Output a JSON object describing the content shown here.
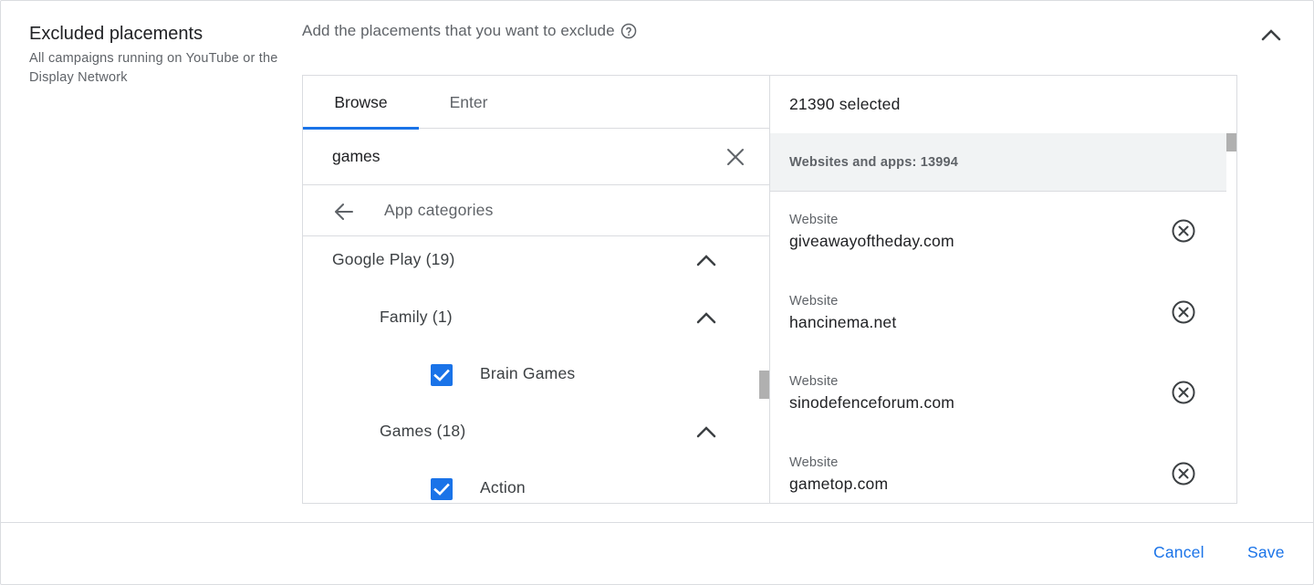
{
  "section": {
    "title": "Excluded placements",
    "subtitle": "All campaigns running on YouTube or the Display Network"
  },
  "prompt": "Add the placements that you want to exclude",
  "icons": {
    "help": "help-circle-icon",
    "collapse": "chevron-up-icon",
    "clear": "close-icon",
    "back": "arrow-back-icon",
    "remove": "remove-circle-icon",
    "checkbox": "checkbox-checked-icon"
  },
  "colors": {
    "accent": "#1a73e8",
    "text": "#202124",
    "muted": "#5f6368",
    "border": "#dadce0",
    "group_bg": "#f1f3f4"
  },
  "tabs": [
    {
      "label": "Browse",
      "active": true
    },
    {
      "label": "Enter",
      "active": false
    }
  ],
  "search": {
    "value": "games",
    "placeholder": ""
  },
  "browse": {
    "back_label": "App categories",
    "tree": [
      {
        "label": "Google Play (19)",
        "level": 0,
        "expanded": true
      },
      {
        "label": "Family (1)",
        "level": 1,
        "expanded": true
      },
      {
        "label": "Brain Games",
        "level": 2,
        "checked": true
      },
      {
        "label": "Games (18)",
        "level": 1,
        "expanded": true
      },
      {
        "label": "Action",
        "level": 2,
        "checked": true
      }
    ]
  },
  "selected": {
    "count_label": "21390 selected",
    "group_label": "Websites and apps: 13994",
    "items": [
      {
        "type": "Website",
        "url": "giveawayoftheday.com"
      },
      {
        "type": "Website",
        "url": "hancinema.net"
      },
      {
        "type": "Website",
        "url": "sinodefenceforum.com"
      },
      {
        "type": "Website",
        "url": "gametop.com"
      }
    ]
  },
  "footer": {
    "cancel_label": "Cancel",
    "save_label": "Save"
  }
}
